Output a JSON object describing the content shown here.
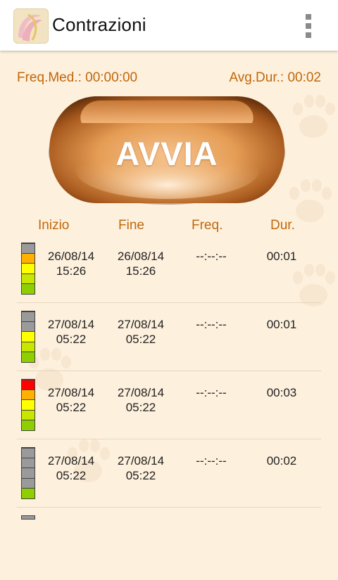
{
  "app": {
    "title": "Contrazioni"
  },
  "stats": {
    "frequency": "Freq.Med.: 00:00:00",
    "duration": "Avg.Dur.: 00:02"
  },
  "start_button": {
    "label": "AVVIA"
  },
  "table": {
    "headers": {
      "start": "Inizio",
      "end": "Fine",
      "freq": "Freq.",
      "dur": "Dur."
    },
    "rows": [
      {
        "start_date": "26/08/14",
        "start_time": "15:26",
        "end_date": "26/08/14",
        "end_time": "15:26",
        "freq": "--:--:--",
        "dur": "00:01",
        "level": 4
      },
      {
        "start_date": "27/08/14",
        "start_time": "05:22",
        "end_date": "27/08/14",
        "end_time": "05:22",
        "freq": "--:--:--",
        "dur": "00:01",
        "level": 3
      },
      {
        "start_date": "27/08/14",
        "start_time": "05:22",
        "end_date": "27/08/14",
        "end_time": "05:22",
        "freq": "--:--:--",
        "dur": "00:03",
        "level": 5
      },
      {
        "start_date": "27/08/14",
        "start_time": "05:22",
        "end_date": "27/08/14",
        "end_time": "05:22",
        "freq": "--:--:--",
        "dur": "00:02",
        "level": 1
      }
    ]
  },
  "colors": {
    "accent": "#c1670a",
    "background": "#fdf0dd",
    "meter_levels": [
      "#8fcf00",
      "#c8e600",
      "#ffff00",
      "#ffb000",
      "#ff0000"
    ],
    "meter_off": "#9a9a9a"
  },
  "icons": {
    "logo": "app-logo-icon",
    "menu": "overflow-menu-icon"
  }
}
